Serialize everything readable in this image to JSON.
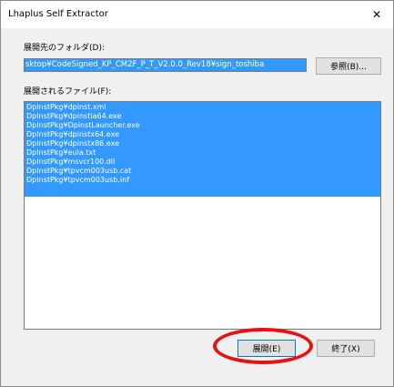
{
  "window": {
    "title": "Lhaplus Self Extractor",
    "close_glyph": "✕"
  },
  "destination": {
    "label": "展開先のフォルダ(D):",
    "path_value": "sktop¥CodeSigned_KP_CM2F_P_T_V2.0.0_Rev18¥sign_toshiba",
    "browse_label": "参照(B)..."
  },
  "files": {
    "label": "展開されるファイル(F):",
    "items": [
      "DpInstPkg¥dpinst.xml",
      "DpInstPkg¥dpinstia64.exe",
      "DpInstPkg¥DpinstLauncher.exe",
      "DpInstPkg¥dpinstx64.exe",
      "DpInstPkg¥dpinstx86.exe",
      "DpInstPkg¥eula.txt",
      "DpInstPkg¥msvcr100.dll",
      "DpInstPkg¥tpvcm003usb.cat",
      "DpInstPkg¥tpvcm003usb.inf"
    ]
  },
  "buttons": {
    "extract_label": "展開(E)",
    "exit_label": "終了(X)"
  },
  "colors": {
    "selection": "#3399ff",
    "annotation": "#e81010",
    "dialog_bg": "#f0f0f0"
  }
}
